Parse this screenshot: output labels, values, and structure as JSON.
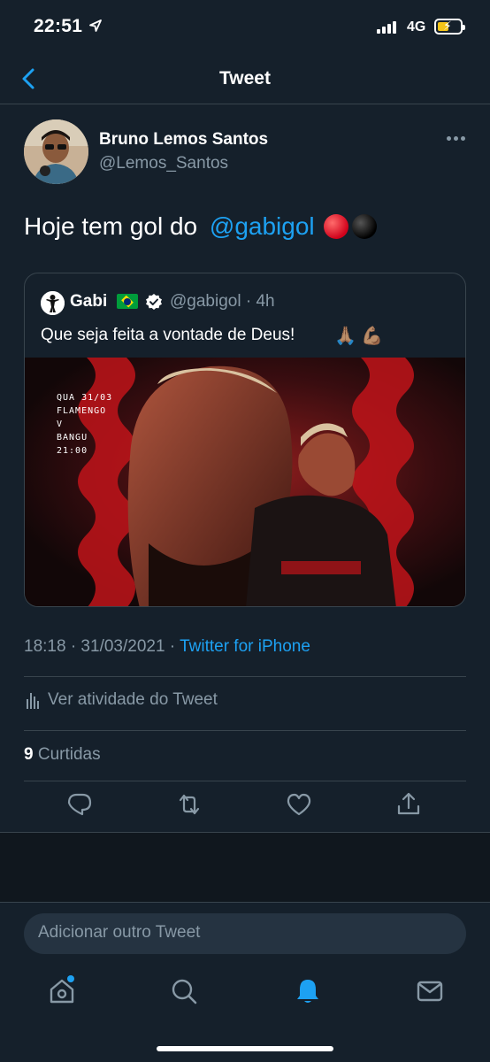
{
  "status_bar": {
    "time": "22:51",
    "network": "4G"
  },
  "nav": {
    "title": "Tweet"
  },
  "tweet": {
    "author_name": "Bruno Lemos Santos",
    "author_handle": "@Lemos_Santos",
    "text_prefix": "Hoje tem gol do ",
    "mention": "@gabigol",
    "timestamp": "18:18 · 31/03/2021 · ",
    "source": "Twitter for iPhone",
    "activity_label": "Ver atividade do Tweet",
    "likes_count": "9",
    "likes_label": "Curtidas"
  },
  "quote": {
    "name": "Gabi",
    "handle_time": "@gabigol · 4h",
    "text": "Que seja feita a vontade de Deus!",
    "emoji_1": "🙏🏽",
    "emoji_2": "💪🏽",
    "poster_lines": [
      "QUA 31/03",
      "FLAMENGO",
      "V",
      "BANGU",
      "21:00"
    ]
  },
  "reply": {
    "placeholder": "Adicionar outro Tweet"
  },
  "colors": {
    "background": "#15202b",
    "accent": "#1da1f2",
    "secondary_text": "#8899a6",
    "divider": "#38444d"
  }
}
